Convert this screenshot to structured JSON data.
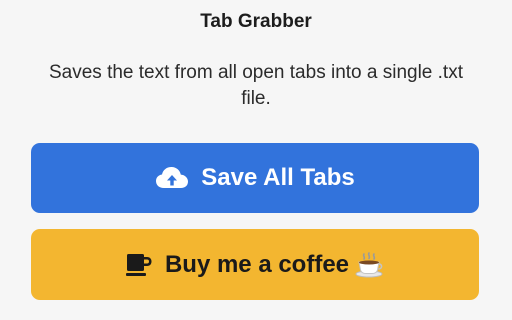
{
  "app": {
    "title": "Tab Grabber",
    "description": "Saves the text from all open tabs into a single .txt file."
  },
  "buttons": {
    "save": {
      "label": "Save All Tabs",
      "icon": "cloud-upload-icon",
      "color": "#3273dc"
    },
    "coffee": {
      "label": "Buy me a coffee",
      "icon": "coffee-mug-icon",
      "trailing_icon": "hot-beverage-emoji",
      "color": "#f3b630"
    }
  }
}
